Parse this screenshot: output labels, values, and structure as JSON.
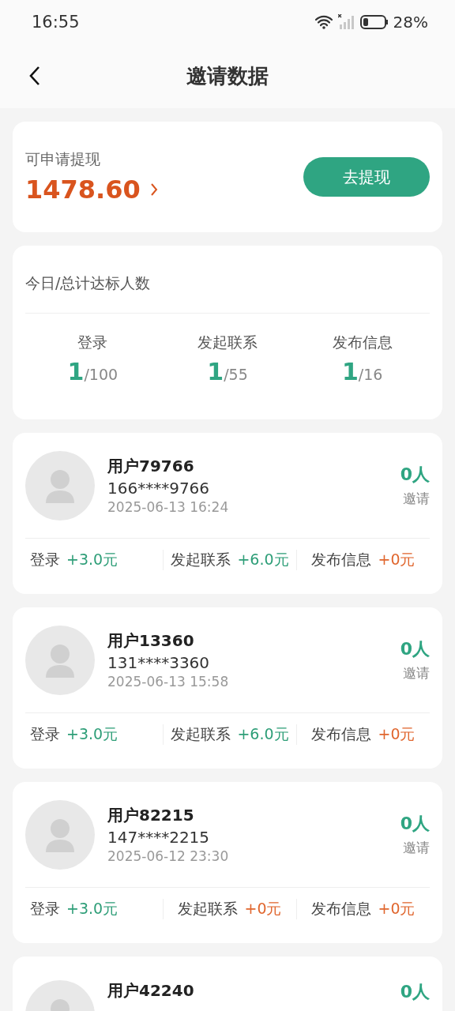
{
  "status_bar": {
    "time": "16:55",
    "battery": "28%"
  },
  "header": {
    "title": "邀请数据"
  },
  "balance": {
    "label": "可申请提现",
    "amount": "1478.60",
    "button": "去提现"
  },
  "stats": {
    "title": "今日/总计达标人数",
    "items": [
      {
        "label": "登录",
        "today": "1",
        "total": "/100"
      },
      {
        "label": "发起联系",
        "today": "1",
        "total": "/55"
      },
      {
        "label": "发布信息",
        "today": "1",
        "total": "/16"
      }
    ]
  },
  "users": [
    {
      "name": "用户79766",
      "phone": "166****9766",
      "time": "2025-06-13 16:24",
      "count": "0人",
      "count_label": "邀请",
      "rewards": [
        {
          "label": "登录",
          "value": "+3.0元",
          "color": "#2e9e78"
        },
        {
          "label": "发起联系",
          "value": "+6.0元",
          "color": "#2e9e78"
        },
        {
          "label": "发布信息",
          "value": "+0元",
          "color": "#e0662e"
        }
      ]
    },
    {
      "name": "用户13360",
      "phone": "131****3360",
      "time": "2025-06-13 15:58",
      "count": "0人",
      "count_label": "邀请",
      "rewards": [
        {
          "label": "登录",
          "value": "+3.0元",
          "color": "#2e9e78"
        },
        {
          "label": "发起联系",
          "value": "+6.0元",
          "color": "#2e9e78"
        },
        {
          "label": "发布信息",
          "value": "+0元",
          "color": "#e0662e"
        }
      ]
    },
    {
      "name": "用户82215",
      "phone": "147****2215",
      "time": "2025-06-12 23:30",
      "count": "0人",
      "count_label": "邀请",
      "rewards": [
        {
          "label": "登录",
          "value": "+3.0元",
          "color": "#2e9e78"
        },
        {
          "label": "发起联系",
          "value": "+0元",
          "color": "#e0662e"
        },
        {
          "label": "发布信息",
          "value": "+0元",
          "color": "#e0662e"
        }
      ]
    },
    {
      "name": "用户42240",
      "count": "0人"
    }
  ]
}
